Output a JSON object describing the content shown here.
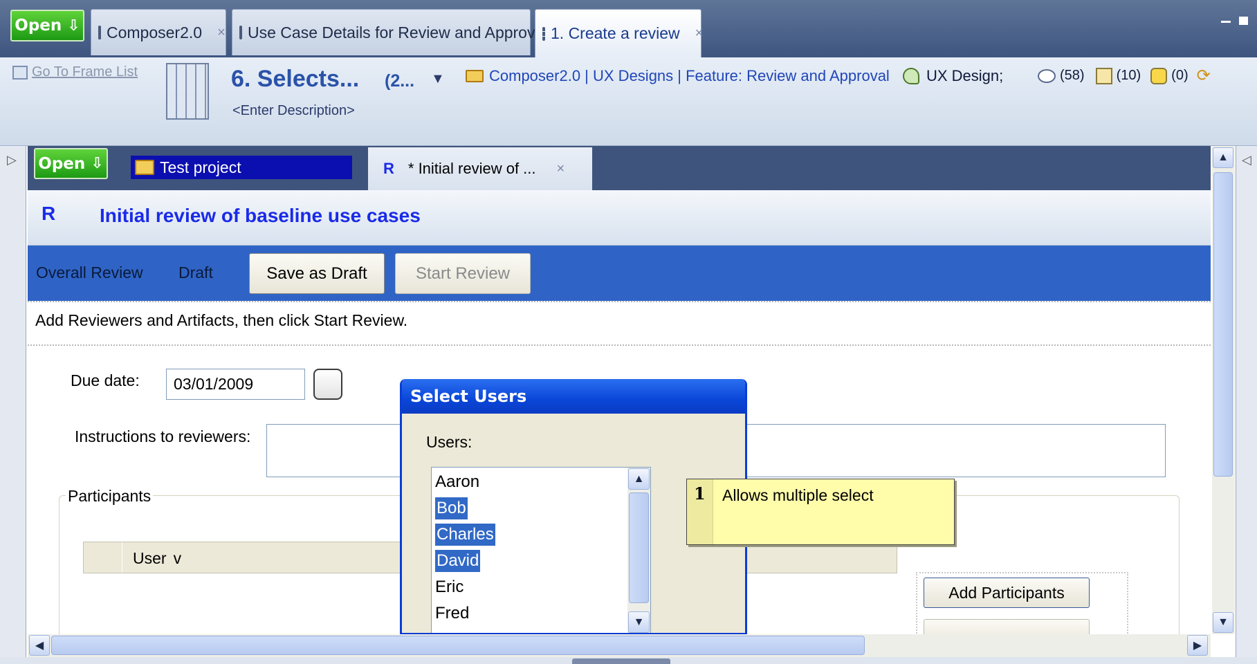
{
  "top_tabs": {
    "open_label": "Open",
    "tabs": [
      {
        "label": "Composer2.0"
      },
      {
        "label": "Use Case Details for Review and Approval"
      },
      {
        "label": "1. Create a review"
      }
    ],
    "close_glyph": "×",
    "window_controls": [
      "minimize",
      "maximize"
    ]
  },
  "frame_header": {
    "go_to_frame_list": "Go To Frame List",
    "frame_title": "6. Selects...",
    "frame_count": "(2...",
    "description_placeholder": "<Enter Description>",
    "breadcrumb": "Composer2.0 | UX Designs | Feature: Review and Approval",
    "design_label": "UX Design;",
    "comments_count": "(58)",
    "edits_count": "(10)",
    "issues_count": "(0)"
  },
  "inner_tabs": {
    "open_label": "Open",
    "project_label": "Test project",
    "doc_tab_icon": "R",
    "doc_tab_label": "* Initial review of ..."
  },
  "review": {
    "icon_letter": "R",
    "title": "Initial review of baseline use cases",
    "overall_label": "Overall Review",
    "status": "Draft",
    "save_button": "Save as Draft",
    "start_button": "Start Review",
    "instructions_hint": "Add Reviewers and Artifacts, then click Start Review.",
    "due_date_label": "Due date:",
    "due_date_value": "03/01/2009",
    "instructions_label": "Instructions to reviewers:",
    "instructions_value": "",
    "participants_label": "Participants",
    "user_column": "User",
    "user_column_sort": "v",
    "add_participants_button": "Add Participants"
  },
  "dialog": {
    "title": "Select Users",
    "users_label": "Users:",
    "users": [
      {
        "name": "Aaron",
        "selected": false
      },
      {
        "name": "Bob",
        "selected": true
      },
      {
        "name": "Charles",
        "selected": true
      },
      {
        "name": "David",
        "selected": true
      },
      {
        "name": "Eric",
        "selected": false
      },
      {
        "name": "Fred",
        "selected": false
      }
    ]
  },
  "annotation": {
    "number": "1",
    "text": "Allows multiple select"
  },
  "colors": {
    "accent_blue": "#2f64c6",
    "title_blue": "#1a2be8",
    "dialog_title": "#0a46d8",
    "note_yellow": "#fffcaa",
    "open_green": "#2fb51f"
  },
  "icons": [
    "download-arrow-icon",
    "folder-icon",
    "document-icon",
    "frame-icon",
    "storyboard-icon",
    "folder-open-icon",
    "ux-design-icon",
    "comment-icon",
    "edit-icon",
    "issue-icon",
    "sync-icon",
    "calendar-icon"
  ]
}
